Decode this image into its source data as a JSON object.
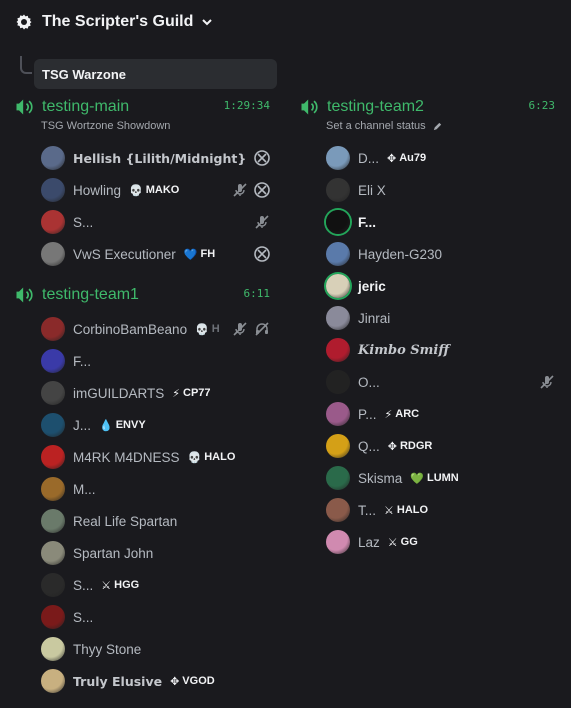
{
  "header": {
    "server_name": "The Scripter's Guild",
    "server_icon": "gear-icon",
    "chevron_icon": "chevron-down-icon"
  },
  "event": {
    "label": "TSG Warzone"
  },
  "colors": {
    "voice_green": "#3fb96b",
    "bg": "#1a1a1e",
    "chip_bg": "#2b2d31"
  },
  "left_channels": [
    {
      "name": "testing-main",
      "time": "1:29:34",
      "status": "TSG Wortzone Showdown",
      "users": [
        {
          "name": "Hellish {Lilith/Midnight}",
          "style": "mono",
          "avatar": "#5a6a8a",
          "tag": "",
          "tagicon": "",
          "icons": [
            "xbox-icon"
          ]
        },
        {
          "name": "Howling",
          "style": "",
          "avatar": "#3b4a6b",
          "tag": "MAKO",
          "tagicon": "💀",
          "icons": [
            "mic-muted-icon",
            "xbox-icon"
          ]
        },
        {
          "name": "S...",
          "style": "",
          "avatar": "#a33",
          "tag": "",
          "tagicon": "",
          "icons": [
            "mic-muted-icon"
          ]
        },
        {
          "name": "VwS Executioner",
          "style": "",
          "avatar": "#777",
          "tag": "FH",
          "tagicon": "💙",
          "icons": [
            "xbox-icon"
          ]
        }
      ]
    },
    {
      "name": "testing-team1",
      "time": "6:11",
      "status": "",
      "users": [
        {
          "name": "CorbinoBamBeano",
          "style": "",
          "avatar": "#8a2a2a",
          "tag": "H",
          "tagicon": "💀",
          "tagmuted": true,
          "icons": [
            "mic-muted-icon",
            "deafened-icon"
          ]
        },
        {
          "name": "F...",
          "style": "",
          "avatar": "#3a3aa8",
          "tag": "",
          "tagicon": "",
          "icons": []
        },
        {
          "name": "imGUILDARTS",
          "style": "",
          "avatar": "#444",
          "tag": "CP77",
          "tagicon": "⚡",
          "icons": []
        },
        {
          "name": "J...",
          "style": "",
          "avatar": "#1d4f6e",
          "tag": "ENVY",
          "tagicon": "💧",
          "icons": []
        },
        {
          "name": "M4RK M4DNESS",
          "style": "",
          "avatar": "#b22",
          "tag": "HALO",
          "tagicon": "💀",
          "icons": []
        },
        {
          "name": "M...",
          "style": "",
          "avatar": "#9a6a2a",
          "tag": "",
          "tagicon": "",
          "icons": []
        },
        {
          "name": "Real Life Spartan",
          "style": "",
          "avatar": "#6a7a6a",
          "tag": "",
          "tagicon": "",
          "icons": []
        },
        {
          "name": "Spartan John",
          "style": "",
          "avatar": "#8a8a7a",
          "tag": "",
          "tagicon": "",
          "icons": []
        },
        {
          "name": "S...",
          "style": "",
          "avatar": "#2a2a2a",
          "tag": "HGG",
          "tagicon": "⚔",
          "icons": []
        },
        {
          "name": "S...",
          "style": "",
          "avatar": "#7a1a1a",
          "tag": "",
          "tagicon": "",
          "icons": []
        },
        {
          "name": "Thyy Stone",
          "style": "",
          "avatar": "#c9c9a0",
          "tag": "",
          "tagicon": "",
          "icons": []
        },
        {
          "name": "Truly Elusive",
          "style": "mono",
          "avatar": "#c8b080",
          "tag": "VGOD",
          "tagicon": "✥",
          "icons": []
        }
      ]
    }
  ],
  "right_channel": {
    "name": "testing-team2",
    "time": "6:23",
    "status": "Set a channel status",
    "status_icon": "pencil-icon",
    "users": [
      {
        "name": "D...",
        "style": "",
        "avatar": "#7a9aba",
        "tag": "Au79",
        "tagicon": "✥",
        "icons": []
      },
      {
        "name": "Eli X",
        "style": "",
        "avatar": "#333",
        "tag": "",
        "tagicon": "",
        "icons": []
      },
      {
        "name": "F...",
        "style": "bold",
        "avatar": "#111",
        "speaking": true,
        "tag": "",
        "tagicon": "",
        "icons": []
      },
      {
        "name": "Hayden-G230",
        "style": "",
        "avatar": "#5a7aaa",
        "tag": "",
        "tagicon": "",
        "icons": []
      },
      {
        "name": "jeric",
        "style": "bold",
        "avatar": "#d8d0b8",
        "speaking": true,
        "tag": "",
        "tagicon": "",
        "icons": []
      },
      {
        "name": "Jinrai",
        "style": "",
        "avatar": "#8a8a9a",
        "tag": "",
        "tagicon": "",
        "icons": []
      },
      {
        "name": "Kimbo Smiff",
        "style": "fancy",
        "avatar": "#b01c2e",
        "tag": "",
        "tagicon": "",
        "icons": []
      },
      {
        "name": "O...",
        "style": "",
        "avatar": "#222",
        "tag": "",
        "tagicon": "",
        "icons": [
          "mic-muted-icon"
        ]
      },
      {
        "name": "P...",
        "style": "",
        "avatar": "#9a5a8a",
        "tag": "ARC",
        "tagicon": "⚡",
        "icons": []
      },
      {
        "name": "Q...",
        "style": "",
        "avatar": "#d4a017",
        "tag": "RDGR",
        "tagicon": "✥",
        "icons": []
      },
      {
        "name": "Skisma",
        "style": "",
        "avatar": "#2a6a4a",
        "tag": "LUMN",
        "tagicon": "💚",
        "icons": []
      },
      {
        "name": "T...",
        "style": "",
        "avatar": "#8a5a4a",
        "tag": "HALO",
        "tagicon": "⚔",
        "icons": []
      },
      {
        "name": "Laz",
        "style": "",
        "avatar": "#d08ab0",
        "tag": "GG",
        "tagicon": "⚔",
        "icons": []
      }
    ]
  }
}
